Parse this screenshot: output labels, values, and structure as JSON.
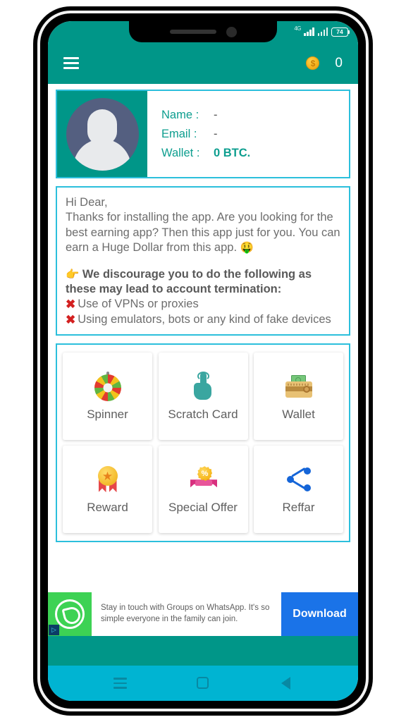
{
  "status_bar": {
    "network_label": "4G",
    "battery_level": "74"
  },
  "app_bar": {
    "menu_icon": "hamburger-menu-icon",
    "coin_icon": "coin-icon",
    "coin_symbol": "$",
    "coin_count": "0"
  },
  "profile": {
    "avatar_icon": "user-avatar-placeholder",
    "rows": [
      {
        "label": "Name :",
        "value": "-"
      },
      {
        "label": "Email :",
        "value": "-"
      },
      {
        "label": "Wallet :",
        "value": "0 BTC."
      }
    ]
  },
  "message": {
    "greeting": "Hi Dear,",
    "body": "Thanks for installing the app. Are you looking for the best earning app? Then this app just for you. You can earn a Huge Dollar from this app.",
    "body_emoji": "🤑",
    "warning_emoji": "👉",
    "warning_heading": "We discourage you to do the following as these may lead to account termination:",
    "prohibited": [
      {
        "mark": "✖",
        "text": "Use of VPNs or proxies"
      },
      {
        "mark": "✖",
        "text": "Using emulators, bots or any kind of fake devices"
      }
    ]
  },
  "menu_grid": {
    "tiles": [
      {
        "label": "Spinner",
        "icon": "spinner-wheel-icon"
      },
      {
        "label": "Scratch Card",
        "icon": "tap-hand-icon"
      },
      {
        "label": "Wallet",
        "icon": "wallet-icon"
      },
      {
        "label": "Reward",
        "icon": "medal-icon"
      },
      {
        "label": "Special Offer",
        "icon": "discount-badge-icon"
      },
      {
        "label": "Reffar",
        "icon": "share-icon"
      }
    ]
  },
  "ad": {
    "icon": "whatsapp-icon",
    "adchoices_label": "▷",
    "text": "Stay in touch with Groups on WhatsApp. It's so simple everyone in the family can join.",
    "cta_label": "Download"
  },
  "system_nav": {
    "recent_icon": "recent-apps-icon",
    "home_icon": "home-icon",
    "back_icon": "back-icon"
  },
  "colors": {
    "app_bar_teal": "#009688",
    "card_border_cyan": "#2cbfdc",
    "nav_bar_cyan": "#00b4d2",
    "ad_cta_blue": "#1a73e8",
    "coin_gold": "#f7b924"
  }
}
